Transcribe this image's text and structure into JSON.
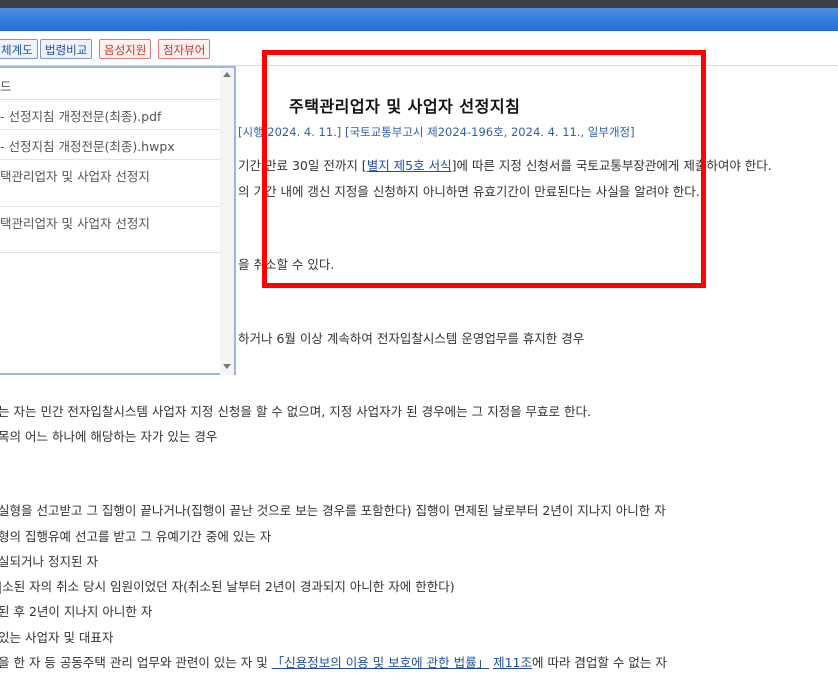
{
  "toolbar": {
    "btn_system": "체계도",
    "btn_compare": "법령비교",
    "btn_voice": "음성지원",
    "btn_braille": "점자뷰어"
  },
  "dropdown": {
    "items": [
      "드",
      "- 선정지침 개정전문(최종).pdf",
      "- 선정지침 개정전문(최종).hwpx",
      "택관리업자 및 사업자 선정지",
      "택관리업자 및 사업자 선정지"
    ]
  },
  "doc": {
    "title": "주택관리업자 및 사업자 선정지침",
    "sub_left": "[시행 2024. 4. 11.]",
    "sub_right": "[국토교통부고시 제2024-196호, 2024. 4. 11., 일부개정]",
    "l1_a": "기간 만료 30일 전까지 [",
    "l1_link": "별지 제5호 서식",
    "l1_b": "]에 따른 지정 신청서를 국토교통부장관에게 제출하여야 한다.",
    "l2": "의 기간 내에 갱신 지정을 신청하지 아니하면 유효기간이 만료된다는 사실을 알려야 한다.",
    "l3": "을 취소할 수 있다.",
    "l4": "하거나 6월 이상 계속하여 전자입찰시스템 운영업무를 휴지한 경우",
    "l5": "는 자는 민간 전자입찰시스템 사업자 지정 신청을 할 수 없으며, 지정 사업자가 된 경우에는 그 지정을 무효로 한다.",
    "l6": "목의 어느 하나에 해당하는 자가 있는 경우",
    "l7": "실형을 선고받고 그 집행이 끝나거나(집행이 끝난 것으로 보는 경우를 포함한다) 집행이 면제된 날로부터 2년이 지나지 아니한 자",
    "l8": "형의 집행유예 선고를 받고 그 유예기간 중에 있는 자",
    "l9": "실되거나 정지된 자",
    "l10": "|소된 자의 취소 당시 임원이었던 자(취소된 날부터 2년이 경과되지 아니한 자에 한한다)",
    "l11": "된 후 2년이 지나지 아니한 자",
    "l12": "있는 사업자 및 대표자",
    "l13_a": "을 한 자 등 공동주택 관리 업무와 관련이 있는 자 및 ",
    "l13_link": "「신용정보의 이용 및 보호에 관한 법률」",
    "l13_mid": " ",
    "l13_link2": "제11조",
    "l13_b": "에 따라 겸업할 수 없는 자"
  }
}
